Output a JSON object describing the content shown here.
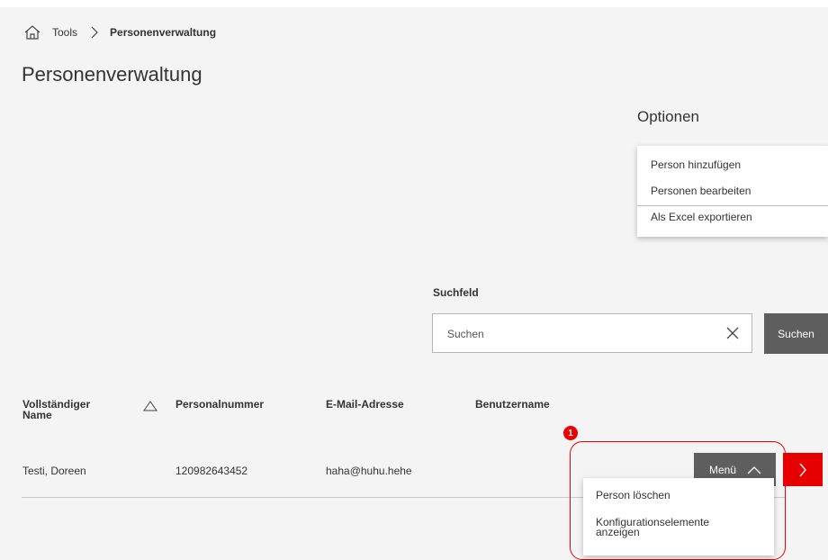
{
  "breadcrumb": {
    "icon": "home-icon",
    "parent": "Tools",
    "current": "Personenverwaltung"
  },
  "page_title": "Personenverwaltung",
  "options": {
    "title": "Optionen",
    "items": [
      "Person hinzufügen",
      "Personen bearbeiten",
      "Als Excel exportieren"
    ]
  },
  "search": {
    "label": "Suchfeld",
    "placeholder": "Suchen",
    "value": "",
    "button": "Suchen"
  },
  "table": {
    "headers": [
      "Vollständiger Name",
      "Personalnummer",
      "E-Mail-Adresse",
      "Benutzername"
    ],
    "sorted_column": "Vollständiger Name",
    "rows": [
      {
        "name": "Testi, Doreen",
        "personnel_number": "120982643452",
        "email": "haha@huhu.hehe",
        "username": ""
      }
    ]
  },
  "row_actions": {
    "callout_number": "1",
    "menu_button": "Menü",
    "menu_items": [
      "Person löschen",
      "Konfigurationselemente anzeigen"
    ]
  },
  "colors": {
    "accent": "#e60000",
    "button_gray": "#5e5e5e",
    "background": "#f4f4f4"
  }
}
